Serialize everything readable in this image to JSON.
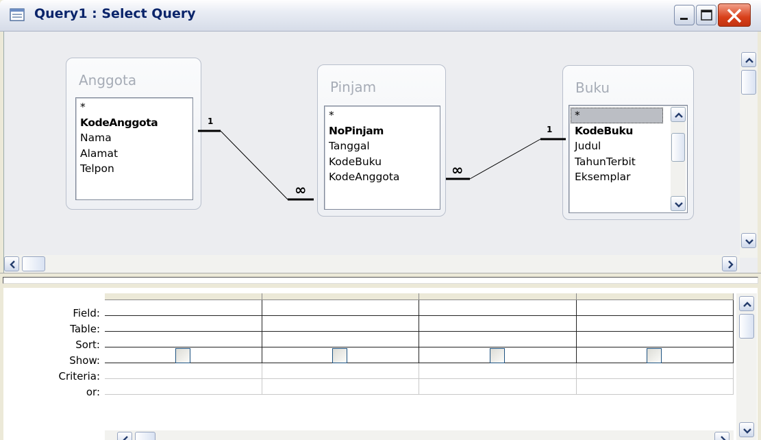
{
  "window": {
    "title": "Query1 : Select Query"
  },
  "tables": [
    {
      "name": "Anggota",
      "fields": [
        {
          "label": "*",
          "key": false
        },
        {
          "label": "KodeAnggota",
          "key": true
        },
        {
          "label": "Nama",
          "key": false
        },
        {
          "label": "Alamat",
          "key": false
        },
        {
          "label": "Telpon",
          "key": false
        }
      ]
    },
    {
      "name": "Pinjam",
      "fields": [
        {
          "label": "*",
          "key": false
        },
        {
          "label": "NoPinjam",
          "key": true
        },
        {
          "label": "Tanggal",
          "key": false
        },
        {
          "label": "KodeBuku",
          "key": false
        },
        {
          "label": "KodeAnggota",
          "key": false
        }
      ]
    },
    {
      "name": "Buku",
      "fields": [
        {
          "label": "*",
          "key": false
        },
        {
          "label": "KodeBuku",
          "key": true
        },
        {
          "label": "Judul",
          "key": false
        },
        {
          "label": "TahunTerbit",
          "key": false
        },
        {
          "label": "Eksemplar",
          "key": false
        }
      ],
      "selected_field": "*"
    }
  ],
  "relationships": [
    {
      "from": "Anggota.KodeAnggota",
      "to": "Pinjam.KodeAnggota",
      "from_card": "1",
      "to_card": "∞"
    },
    {
      "from": "Pinjam.KodeBuku",
      "to": "Buku.KodeBuku",
      "from_card": "∞",
      "to_card": "1"
    }
  ],
  "grid": {
    "row_labels": [
      "Field:",
      "Table:",
      "Sort:",
      "Show:",
      "Criteria:",
      "or:"
    ],
    "column_count": 4
  },
  "icons": {
    "app": "query-icon",
    "minimize": "minimize-icon",
    "maximize": "maximize-icon",
    "close": "close-icon"
  },
  "colors": {
    "title_text": "#0a246a",
    "close_button": "#d8401a",
    "table_header_text": "#a6acb6",
    "pane_background": "#ecedf0"
  }
}
